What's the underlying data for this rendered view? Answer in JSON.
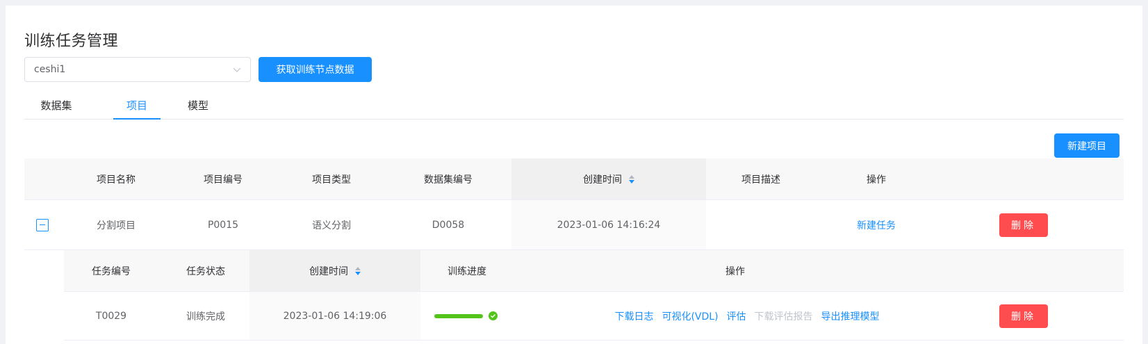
{
  "page": {
    "title": "训练任务管理"
  },
  "toolbar": {
    "select_value": "ceshi1",
    "fetch_button": "获取训练节点数据",
    "new_project_button": "新建项目"
  },
  "tabs": [
    {
      "label": "数据集",
      "active": false
    },
    {
      "label": "项目",
      "active": true
    },
    {
      "label": "模型",
      "active": false
    }
  ],
  "project_table": {
    "columns": [
      "项目名称",
      "项目编号",
      "项目类型",
      "数据集编号",
      "创建时间",
      "项目描述",
      "操作"
    ],
    "sorted_column": "创建时间",
    "rows": [
      {
        "name": "分割项目",
        "code": "P0015",
        "type": "语义分割",
        "dataset": "D0058",
        "created": "2023-01-06 14:16:24",
        "description": "",
        "action_link": "新建任务",
        "delete": "删除"
      }
    ]
  },
  "task_table": {
    "columns": [
      "任务编号",
      "任务状态",
      "创建时间",
      "训练进度",
      "操作"
    ],
    "rows": [
      {
        "code": "T0029",
        "status": "训练完成",
        "created": "2023-01-06 14:19:06",
        "progress": 1.0,
        "actions": [
          "下载日志",
          "可视化(VDL)",
          "评估",
          "下载评估报告",
          "导出推理模型"
        ],
        "disabled_actions": [
          "下载评估报告"
        ],
        "delete": "删除"
      }
    ]
  },
  "colors": {
    "primary": "#1890ff",
    "danger": "#ff4d4f",
    "success": "#52c41a",
    "disabled": "#c0c4cc"
  }
}
